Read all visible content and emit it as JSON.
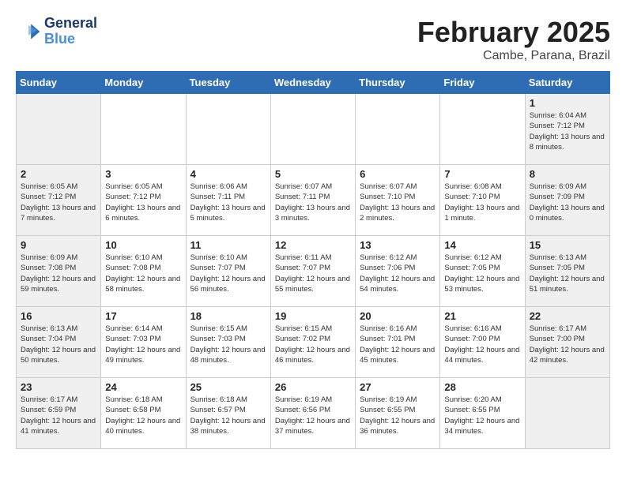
{
  "header": {
    "logo": {
      "line1": "General",
      "line2": "Blue"
    },
    "month": "February 2025",
    "location": "Cambe, Parana, Brazil"
  },
  "weekdays": [
    "Sunday",
    "Monday",
    "Tuesday",
    "Wednesday",
    "Thursday",
    "Friday",
    "Saturday"
  ],
  "weeks": [
    [
      {
        "day": "",
        "info": ""
      },
      {
        "day": "",
        "info": ""
      },
      {
        "day": "",
        "info": ""
      },
      {
        "day": "",
        "info": ""
      },
      {
        "day": "",
        "info": ""
      },
      {
        "day": "",
        "info": ""
      },
      {
        "day": "1",
        "info": "Sunrise: 6:04 AM\nSunset: 7:12 PM\nDaylight: 13 hours and 8 minutes."
      }
    ],
    [
      {
        "day": "2",
        "info": "Sunrise: 6:05 AM\nSunset: 7:12 PM\nDaylight: 13 hours and 7 minutes."
      },
      {
        "day": "3",
        "info": "Sunrise: 6:05 AM\nSunset: 7:12 PM\nDaylight: 13 hours and 6 minutes."
      },
      {
        "day": "4",
        "info": "Sunrise: 6:06 AM\nSunset: 7:11 PM\nDaylight: 13 hours and 5 minutes."
      },
      {
        "day": "5",
        "info": "Sunrise: 6:07 AM\nSunset: 7:11 PM\nDaylight: 13 hours and 3 minutes."
      },
      {
        "day": "6",
        "info": "Sunrise: 6:07 AM\nSunset: 7:10 PM\nDaylight: 13 hours and 2 minutes."
      },
      {
        "day": "7",
        "info": "Sunrise: 6:08 AM\nSunset: 7:10 PM\nDaylight: 13 hours and 1 minute."
      },
      {
        "day": "8",
        "info": "Sunrise: 6:09 AM\nSunset: 7:09 PM\nDaylight: 13 hours and 0 minutes."
      }
    ],
    [
      {
        "day": "9",
        "info": "Sunrise: 6:09 AM\nSunset: 7:08 PM\nDaylight: 12 hours and 59 minutes."
      },
      {
        "day": "10",
        "info": "Sunrise: 6:10 AM\nSunset: 7:08 PM\nDaylight: 12 hours and 58 minutes."
      },
      {
        "day": "11",
        "info": "Sunrise: 6:10 AM\nSunset: 7:07 PM\nDaylight: 12 hours and 56 minutes."
      },
      {
        "day": "12",
        "info": "Sunrise: 6:11 AM\nSunset: 7:07 PM\nDaylight: 12 hours and 55 minutes."
      },
      {
        "day": "13",
        "info": "Sunrise: 6:12 AM\nSunset: 7:06 PM\nDaylight: 12 hours and 54 minutes."
      },
      {
        "day": "14",
        "info": "Sunrise: 6:12 AM\nSunset: 7:05 PM\nDaylight: 12 hours and 53 minutes."
      },
      {
        "day": "15",
        "info": "Sunrise: 6:13 AM\nSunset: 7:05 PM\nDaylight: 12 hours and 51 minutes."
      }
    ],
    [
      {
        "day": "16",
        "info": "Sunrise: 6:13 AM\nSunset: 7:04 PM\nDaylight: 12 hours and 50 minutes."
      },
      {
        "day": "17",
        "info": "Sunrise: 6:14 AM\nSunset: 7:03 PM\nDaylight: 12 hours and 49 minutes."
      },
      {
        "day": "18",
        "info": "Sunrise: 6:15 AM\nSunset: 7:03 PM\nDaylight: 12 hours and 48 minutes."
      },
      {
        "day": "19",
        "info": "Sunrise: 6:15 AM\nSunset: 7:02 PM\nDaylight: 12 hours and 46 minutes."
      },
      {
        "day": "20",
        "info": "Sunrise: 6:16 AM\nSunset: 7:01 PM\nDaylight: 12 hours and 45 minutes."
      },
      {
        "day": "21",
        "info": "Sunrise: 6:16 AM\nSunset: 7:00 PM\nDaylight: 12 hours and 44 minutes."
      },
      {
        "day": "22",
        "info": "Sunrise: 6:17 AM\nSunset: 7:00 PM\nDaylight: 12 hours and 42 minutes."
      }
    ],
    [
      {
        "day": "23",
        "info": "Sunrise: 6:17 AM\nSunset: 6:59 PM\nDaylight: 12 hours and 41 minutes."
      },
      {
        "day": "24",
        "info": "Sunrise: 6:18 AM\nSunset: 6:58 PM\nDaylight: 12 hours and 40 minutes."
      },
      {
        "day": "25",
        "info": "Sunrise: 6:18 AM\nSunset: 6:57 PM\nDaylight: 12 hours and 38 minutes."
      },
      {
        "day": "26",
        "info": "Sunrise: 6:19 AM\nSunset: 6:56 PM\nDaylight: 12 hours and 37 minutes."
      },
      {
        "day": "27",
        "info": "Sunrise: 6:19 AM\nSunset: 6:55 PM\nDaylight: 12 hours and 36 minutes."
      },
      {
        "day": "28",
        "info": "Sunrise: 6:20 AM\nSunset: 6:55 PM\nDaylight: 12 hours and 34 minutes."
      },
      {
        "day": "",
        "info": ""
      }
    ]
  ]
}
